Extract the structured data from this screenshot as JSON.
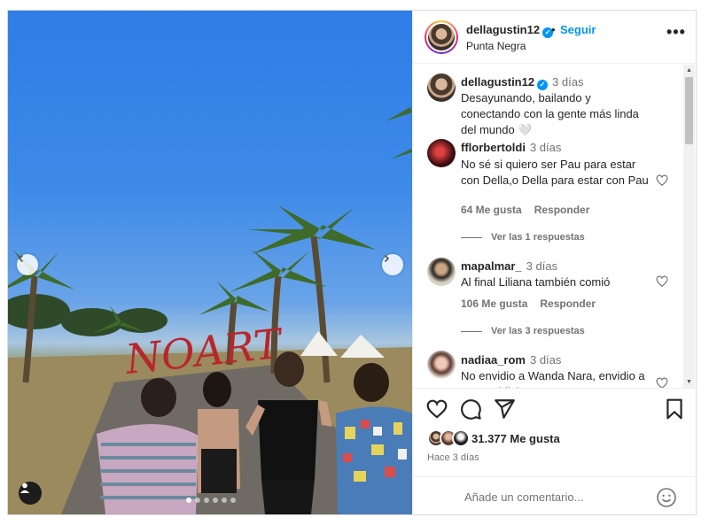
{
  "header": {
    "username": "dellagustin12",
    "separator": "•",
    "follow_label": "Seguir",
    "location": "Punta Negra",
    "more_label": "•••"
  },
  "media": {
    "sign_text": "NOART",
    "carousel_count": 6,
    "carousel_active": 1
  },
  "caption": {
    "username": "dellagustin12",
    "time": "3 días",
    "text": "Desayunando, bailando y conectando con la gente más linda del mundo 🤍"
  },
  "comments": [
    {
      "username": "fflorbertoldi",
      "time": "3 días",
      "text": "No sé si quiero ser Pau para estar con Della,o Della para estar con Pau",
      "likes": "64 Me gusta",
      "reply_label": "Responder",
      "view_replies": "Ver las 1 respuestas"
    },
    {
      "username": "mapalmar_",
      "time": "3 días",
      "text": "Al final Liliana también comió",
      "likes": "106 Me gusta",
      "reply_label": "Responder",
      "view_replies": "Ver las 3 respuestas"
    },
    {
      "username": "nadiaa_rom",
      "time": "3 días",
      "text": "No envidio a Wanda Nara, envidio a Pau Baldini"
    }
  ],
  "actions": {
    "likes_count": "31.377",
    "likes_label": "Me gusta",
    "post_time": "Hace 3 días",
    "comment_placeholder": "Añade un comentario..."
  },
  "colors": {
    "accent": "#0095f6",
    "text": "#262626",
    "muted": "#737373",
    "border": "#dbdbdb"
  }
}
